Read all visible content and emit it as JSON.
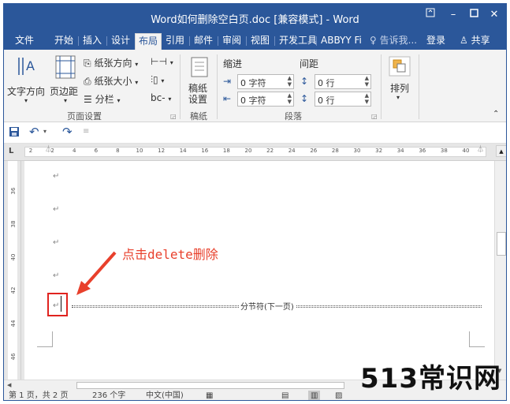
{
  "window": {
    "title": "Word如何删除空白页.doc [兼容模式] - Word"
  },
  "tabs": [
    "文件",
    "开始",
    "插入",
    "设计",
    "布局",
    "引用",
    "邮件",
    "审阅",
    "视图",
    "开发工具",
    "ABBYY Fi"
  ],
  "active_tab": "布局",
  "tell_me": "告诉我...",
  "login": "登录",
  "share": "共享",
  "ribbon": {
    "page_setup": {
      "text_direction": "文字方向",
      "margins": "页边距",
      "orientation": "纸张方向",
      "size": "纸张大小",
      "columns": "分栏",
      "label": "页面设置"
    },
    "draft": {
      "button": "稿纸\n设置",
      "button_line1": "稿纸",
      "button_line2": "设置",
      "label": "稿纸"
    },
    "paragraph": {
      "indent_label": "缩进",
      "spacing_label": "间距",
      "indent_left": "0 字符",
      "indent_right": "0 字符",
      "space_before": "0 行",
      "space_after": "0 行",
      "label": "段落"
    },
    "arrange": {
      "label": "排列"
    }
  },
  "ruler_ticks": [
    "2",
    "2",
    "4",
    "6",
    "8",
    "10",
    "12",
    "14",
    "16",
    "18",
    "20",
    "22",
    "24",
    "26",
    "28",
    "30",
    "32",
    "34",
    "36",
    "38",
    "40"
  ],
  "vruler_ticks": [
    "36",
    "38",
    "40",
    "42",
    "44",
    "46"
  ],
  "document": {
    "annotation": "点击delete删除",
    "section_break": "分节符(下一页)"
  },
  "status": {
    "page": "第 1 页，共 2 页",
    "words": "236 个字",
    "language": "中文(中国)"
  },
  "watermark": "513常识网",
  "colors": {
    "accent": "#2b579a",
    "annotation": "#e8402c"
  }
}
